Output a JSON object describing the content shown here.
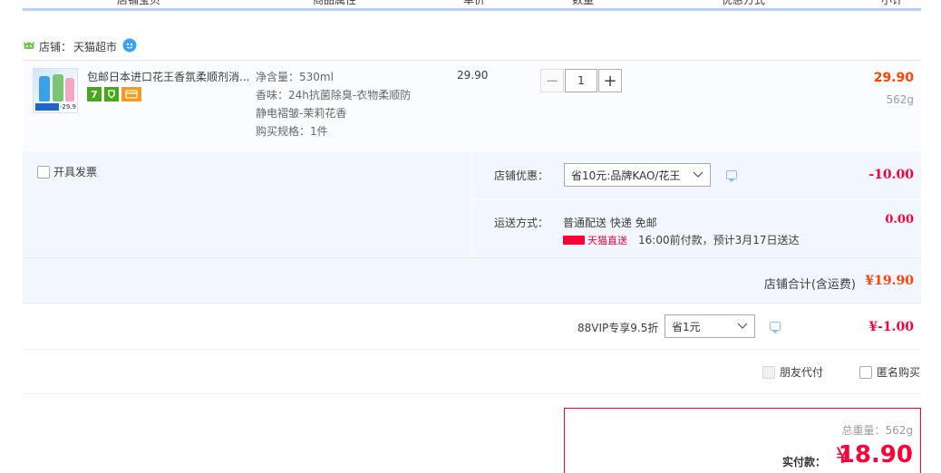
{
  "header": {
    "columns": [
      "店铺宝贝",
      "商品属性",
      "单价",
      "数量",
      "优惠方式",
      "小计"
    ]
  },
  "shop": {
    "label": "店铺：",
    "name": "天猫超市"
  },
  "item": {
    "title": "包邮日本进口花王香氛柔顺剂消...",
    "thumb_price": "-29.9",
    "badges": [
      {
        "text": "7",
        "color": "#4aa71c"
      },
      {
        "text": "",
        "color": "#4aa71c"
      },
      {
        "text": "",
        "color": "#f59a1b"
      }
    ],
    "sku_lines": [
      "净含量：530ml",
      "香味：24h抗菌除臭-衣物柔顺防",
      "静电褶皱-茉莉花香",
      "购买规格：1件"
    ],
    "price": "29.90",
    "quantity": "1",
    "qty_minus": "−",
    "qty_plus": "+",
    "subtotal": "29.90",
    "weight": "562g"
  },
  "options": {
    "invoice_label": "开具发票",
    "shop_discount_label": "店铺优惠：",
    "shop_discount_value": "省10元:品牌KAO/花王",
    "shop_discount_amount": "-10.00",
    "shipping_label": "运送方式：",
    "shipping_value": "普通配送 快递 免邮",
    "shipping_tag": "天猫直送",
    "shipping_eta": "16:00前付款，预计3月17日送达",
    "shipping_amount": "0.00"
  },
  "shop_total": {
    "label": "店铺合计(含运费)",
    "value": "¥19.90"
  },
  "vip": {
    "label": "88VIP专享9.5折",
    "select_value": "省1元",
    "amount": "¥-1.00"
  },
  "extras": {
    "friend_pay": "朋友代付",
    "anonymous": "匿名购买"
  },
  "payment": {
    "total_weight": "总重量：562g",
    "label": "实付款：",
    "currency": "¥",
    "amount": "18.90"
  },
  "colors": {
    "accent_red": "#ff0036",
    "orange": "#ff4400",
    "header_blue": "#b2d1ff",
    "panel_blue": "#f2f7ff"
  }
}
